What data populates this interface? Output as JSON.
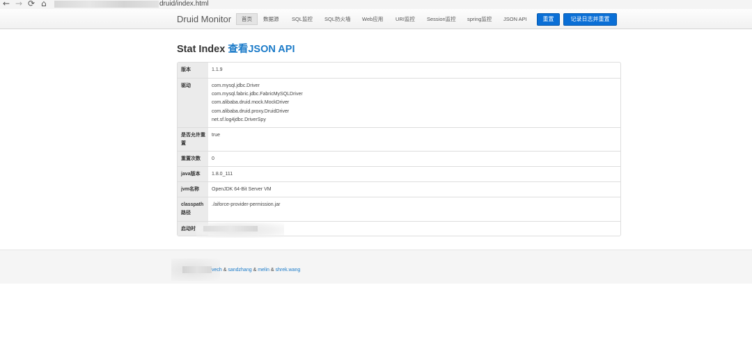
{
  "browser": {
    "back_icon": "←",
    "forward_icon": "→",
    "reload_icon": "⟳",
    "home_icon": "⌂",
    "url_visible": "druid/index.html"
  },
  "navbar": {
    "brand": "Druid Monitor",
    "items": [
      "首页",
      "数据源",
      "SQL监控",
      "SQL防火墙",
      "Web应用",
      "URI监控",
      "Session监控",
      "spring监控",
      "JSON API"
    ],
    "reset_button": "重置",
    "log_reset_button": "记录日志并重置"
  },
  "heading": {
    "title": "Stat Index",
    "link": "查看JSON API"
  },
  "stats": {
    "version_label": "版本",
    "version_value": "1.1.9",
    "driver_label": "驱动",
    "drivers": [
      "com.mysql.jdbc.Driver",
      "com.mysql.fabric.jdbc.FabricMySQLDriver",
      "com.alibaba.druid.mock.MockDriver",
      "com.alibaba.druid.proxy.DruidDriver",
      "net.sf.log4jdbc.DriverSpy"
    ],
    "reset_enable_label": "是否允许重置",
    "reset_enable_value": "true",
    "reset_count_label": "重置次数",
    "reset_count_value": "0",
    "java_version_label": "java版本",
    "java_version_value": "1.8.0_111",
    "jvm_name_label": "jvm名称",
    "jvm_name_value": "OpenJDK 64-Bit Server VM",
    "classpath_label": "classpath路径",
    "classpath_value": "./aiforce-provider-permission.jar",
    "start_time_label": "启动时"
  },
  "footer": {
    "credit_prefix": "vech",
    "sep1": " & ",
    "author2": "sandzhang",
    "sep2": " & ",
    "author3": "melin",
    "sep3": " & ",
    "author4": "shrek.wang"
  },
  "colors": {
    "primary_button": "#0a6fd6",
    "link": "#1a7ac8",
    "table_key_bg": "#ebebeb"
  }
}
